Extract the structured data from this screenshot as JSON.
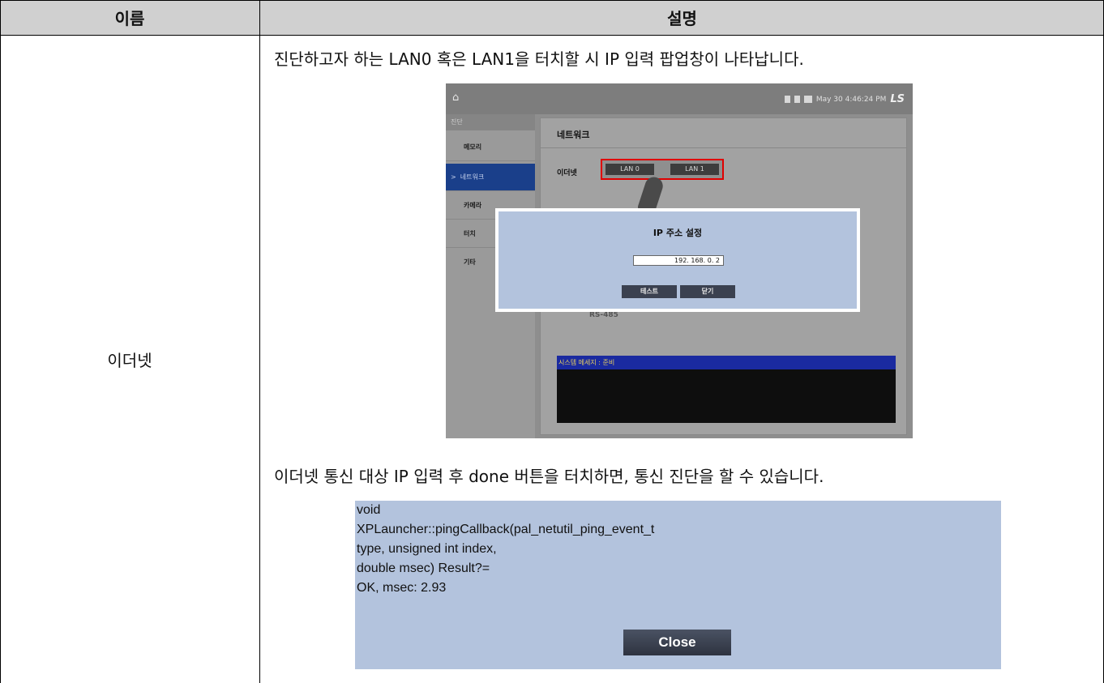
{
  "table": {
    "header_name": "이름",
    "header_desc": "설명",
    "row_name": "이더넷",
    "desc_line1": "진단하고자 하는 LAN0 혹은 LAN1을 터치할 시 IP 입력 팝업창이 나타납니다.",
    "desc_line2": "이더넷 통신 대상 IP 입력 후 done 버튼을 터치하면, 통신 진단을 할 수 있습니다."
  },
  "screen1": {
    "datetime": "May 30 4:46:24 PM",
    "logo": "LS",
    "sidebar_header": "진단",
    "sidebar_items": [
      "메모리",
      "네트워크",
      "카메라",
      "터치",
      "기타"
    ],
    "active_marker": ">",
    "page_title": "네트워크",
    "ethernet_label": "이더넷",
    "lan0": "LAN 0",
    "lan1": "LAN 1",
    "rs_label": "RS-485",
    "popup_title": "IP 주소 설정",
    "ip_value": "192.  168.    0.   2",
    "test_button": "테스트",
    "close_button": "닫기",
    "system_message": "시스템 메세지 : 준비"
  },
  "screen2": {
    "lines": [
      "void",
      "XPLauncher::pingCallback(pal_netutil_ping_event_t",
      "type, unsigned int index,",
      "double msec) Result?=",
      "OK, msec: 2.93"
    ],
    "close_button": "Close"
  }
}
